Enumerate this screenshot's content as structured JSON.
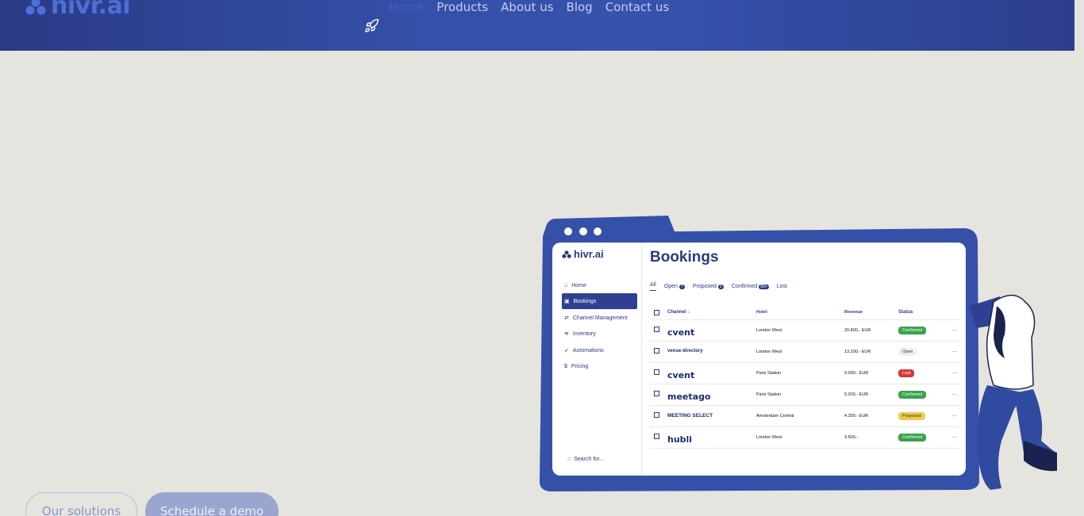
{
  "header": {
    "logo_text": "hivr.ai",
    "nav": [
      "Home",
      "Products",
      "About us",
      "Blog",
      "Contact us"
    ],
    "active_nav": "Home"
  },
  "hero": {
    "buttons": {
      "solutions": "Our solutions",
      "demo": "Schedule a demo"
    }
  },
  "mockup": {
    "logo_text": "hivr.ai",
    "sidebar": [
      "Home",
      "Bookings",
      "Channel Management",
      "Inventory",
      "Automations",
      "Pricing"
    ],
    "search_placeholder": "Search for...",
    "title": "Bookings",
    "tabs": [
      {
        "label": "All",
        "count": ""
      },
      {
        "label": "Open",
        "count": "7"
      },
      {
        "label": "Proposed",
        "count": "2"
      },
      {
        "label": "Confirmed",
        "count": "99+"
      },
      {
        "label": "Lost",
        "count": ""
      }
    ],
    "columns": {
      "channel": "Channel",
      "hotel": "Hotel",
      "revenue": "Revenue",
      "status": "Status"
    },
    "rows": [
      {
        "channel": "cvent",
        "hotel": "London West",
        "revenue": "20.800,- EUR",
        "status": "Confirmed"
      },
      {
        "channel": "venue directory",
        "hotel": "London West",
        "revenue": "13.200,- EUR",
        "status": "Open"
      },
      {
        "channel": "cvent",
        "hotel": "Paris Station",
        "revenue": "9.000,- EUR",
        "status": "Lost"
      },
      {
        "channel": "meetago",
        "hotel": "Paris Station",
        "revenue": "5.200,- EUR",
        "status": "Confirmed"
      },
      {
        "channel": "MEETING SELECT",
        "hotel": "Amsterdam Central",
        "revenue": "4.200,- EUR",
        "status": "Proposed"
      },
      {
        "channel": "hubli",
        "hotel": "London West",
        "revenue": "3.500,-",
        "status": "Confirmed"
      }
    ],
    "more": "..."
  },
  "colors": {
    "header": "#3550a8",
    "accent": "#2a3a84",
    "confirmed": "#3aa24a",
    "lost": "#d33a3a",
    "proposed": "#f2c94c"
  }
}
